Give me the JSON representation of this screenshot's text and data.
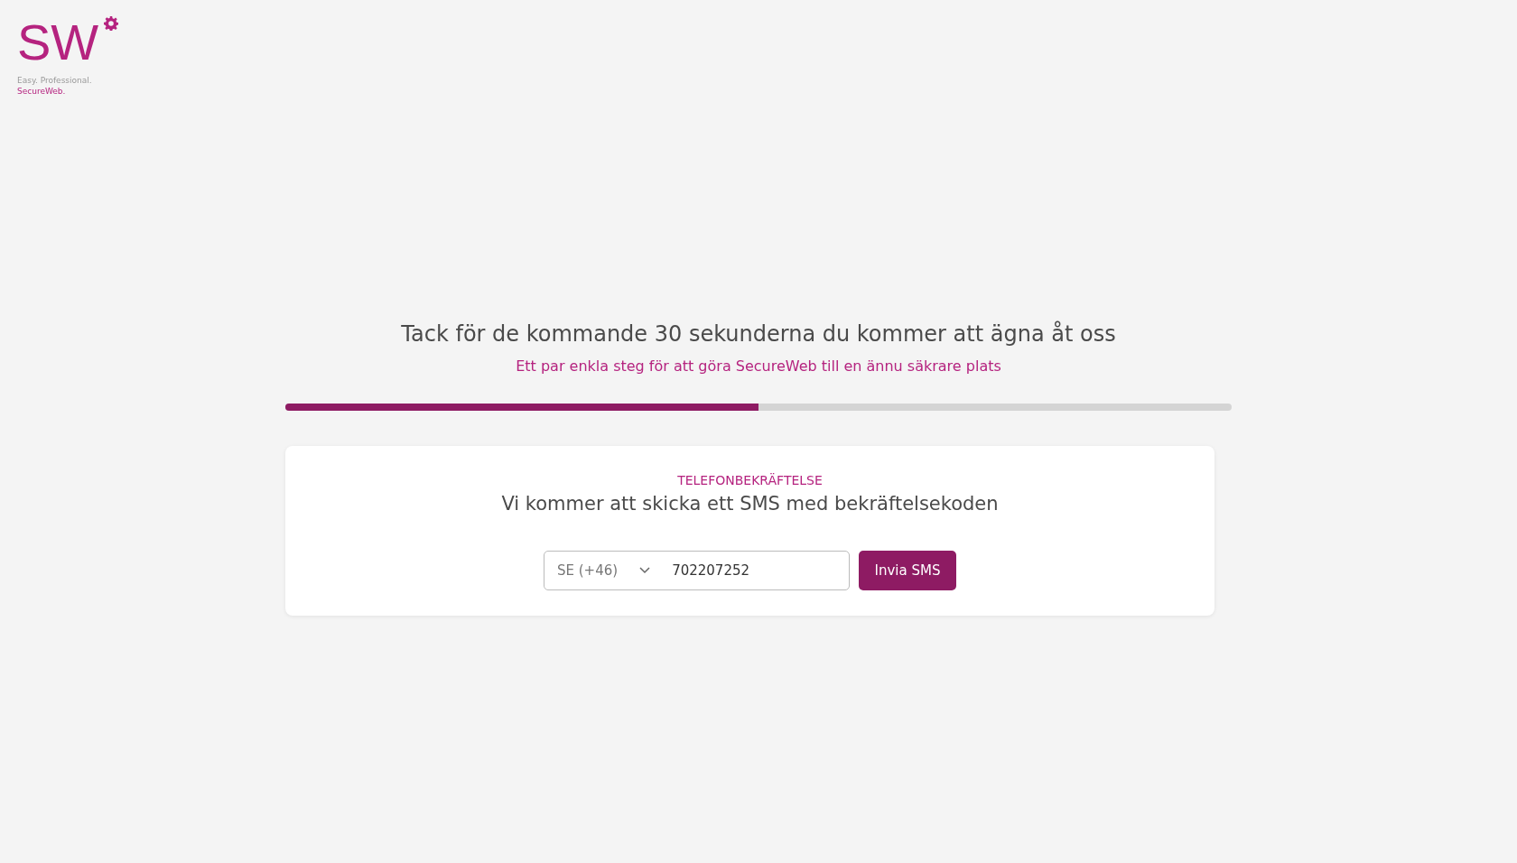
{
  "logo": {
    "mark": "SW",
    "tagline": "Easy. Professional.",
    "brand": "SecureWeb."
  },
  "heading": "Tack för de kommande 30 sekunderna du kommer att ägna åt oss",
  "subheading": "Ett par enkla steg för att göra SecureWeb till en ännu säkrare plats",
  "progress": {
    "level": 0.5
  },
  "card": {
    "label": "TELEFONBEKRÄFTELSE",
    "title": "Vi kommer att skicka ett SMS med bekräftelsekoden",
    "country": {
      "value": "SE (+46)"
    },
    "phone": {
      "value": "702207252"
    },
    "button": "Invia SMS"
  }
}
